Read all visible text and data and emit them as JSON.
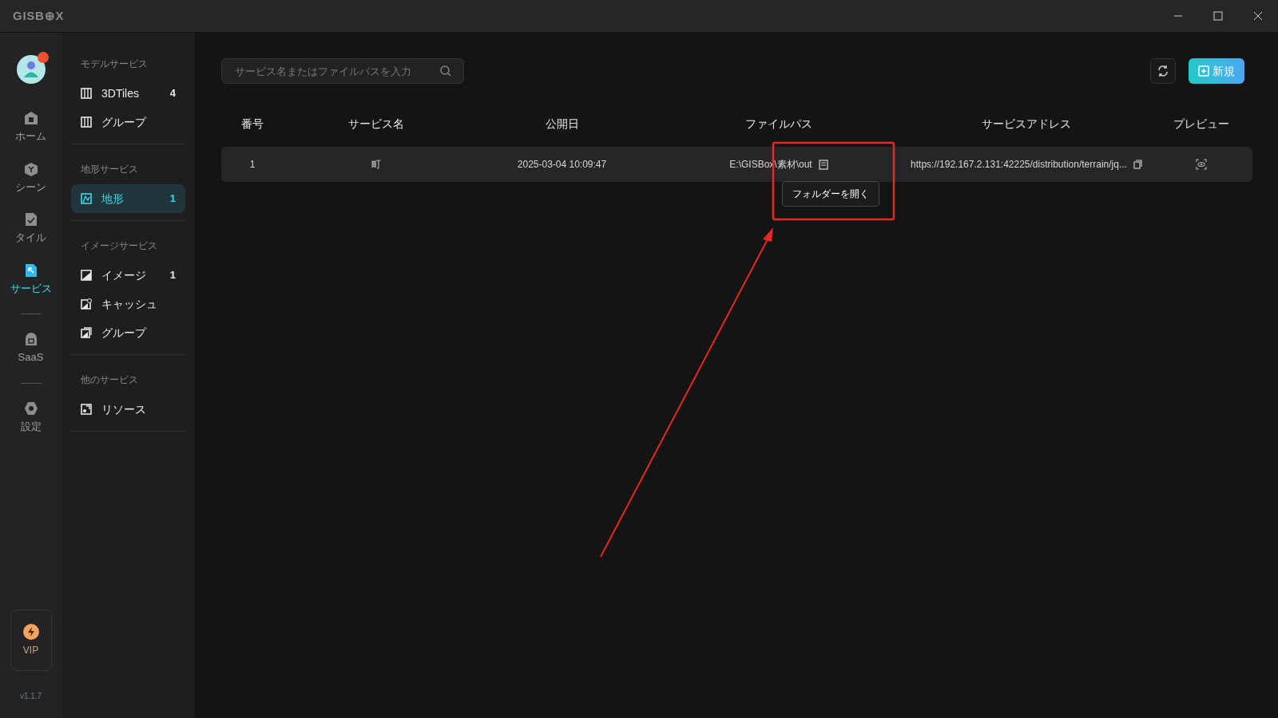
{
  "window": {
    "logo": "GISB⊕X"
  },
  "nav": {
    "items": [
      {
        "kind": "item",
        "label": "ホーム",
        "selected": false
      },
      {
        "kind": "item",
        "label": "シーン",
        "selected": false
      },
      {
        "kind": "item",
        "label": "タイル",
        "selected": false
      },
      {
        "kind": "item",
        "label": "サービス",
        "selected": true
      },
      {
        "kind": "divider"
      },
      {
        "kind": "item",
        "label": "SaaS",
        "selected": false
      },
      {
        "kind": "divider"
      },
      {
        "kind": "item",
        "label": "設定",
        "selected": false
      }
    ],
    "vip": "VIP",
    "version": "v1.1.7"
  },
  "sidebar": {
    "sections": [
      {
        "title": "モデルサービス",
        "items": [
          {
            "label": "3DTiles",
            "count": "4",
            "selected": false
          },
          {
            "label": "グループ",
            "selected": false
          }
        ]
      },
      {
        "title": "地形サービス",
        "items": [
          {
            "label": "地形",
            "count": "1",
            "selected": true
          }
        ]
      },
      {
        "title": "イメージサービス",
        "items": [
          {
            "label": "イメージ",
            "count": "1",
            "selected": false
          },
          {
            "label": "キャッシュ",
            "selected": false
          },
          {
            "label": "グループ",
            "selected": false
          }
        ]
      },
      {
        "title": "他のサービス",
        "items": [
          {
            "label": "リソース",
            "selected": false
          }
        ]
      }
    ]
  },
  "toolbar": {
    "search_placeholder": "サービス名またはファイルパスを入力",
    "new_button": "新規"
  },
  "table": {
    "columns": [
      "番号",
      "サービス名",
      "公開日",
      "ファイルパス",
      "サービスアドレス",
      "プレビュー"
    ],
    "rows": [
      {
        "number": "1",
        "name": "町",
        "date": "2025-03-04 10:09:47",
        "path": "E:\\GISBox\\素材\\out",
        "address": "https://192.167.2.131:42225/distribution/terrain/jq..."
      }
    ]
  },
  "tooltip": "フォルダーを開く"
}
